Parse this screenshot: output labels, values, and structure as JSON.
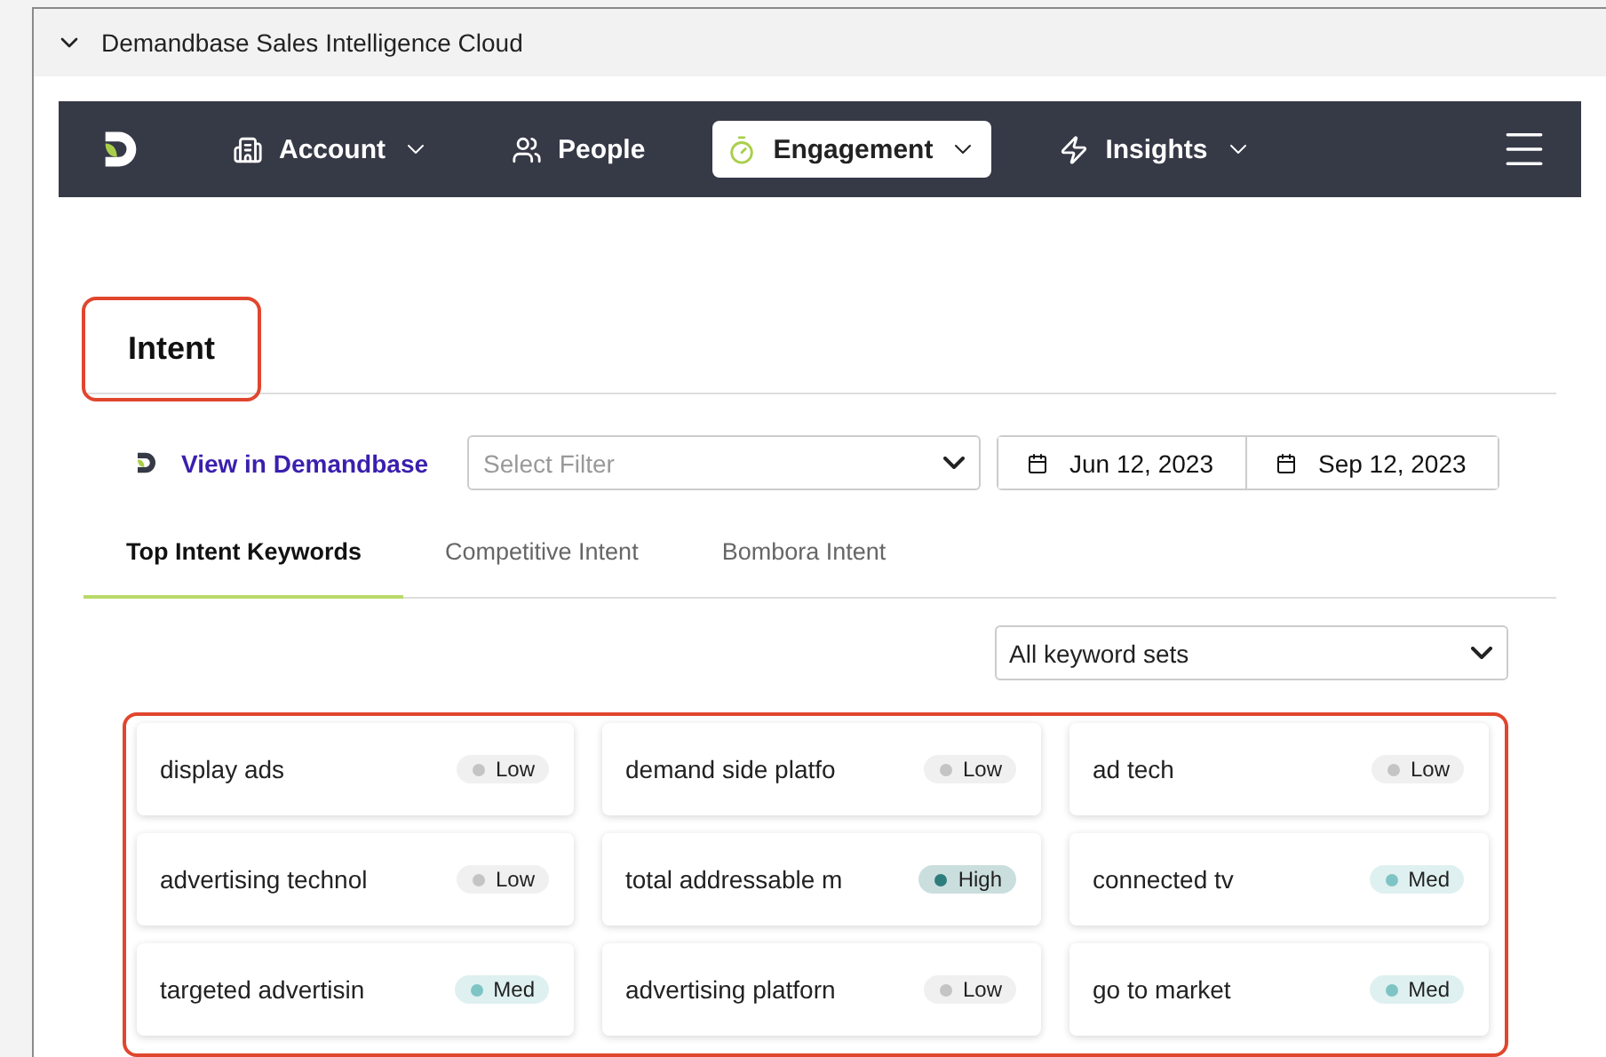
{
  "panel": {
    "title": "Demandbase Sales Intelligence Cloud",
    "expanded": true
  },
  "nav": {
    "items": [
      {
        "label": "Account",
        "kind": "building",
        "dropdown": true,
        "selected": false
      },
      {
        "label": "People",
        "kind": "people",
        "dropdown": false,
        "selected": false
      },
      {
        "label": "Engagement",
        "kind": "stopwatch",
        "dropdown": true,
        "selected": true
      },
      {
        "label": "Insights",
        "kind": "bolt",
        "dropdown": true,
        "selected": false
      }
    ]
  },
  "section": {
    "title": "Intent",
    "highlighted": true
  },
  "toolbar": {
    "link": "View in Demandbase",
    "filter": {
      "placeholder": "Select Filter"
    },
    "start_date": "Jun 12, 2023",
    "end_date": "Sep 12, 2023"
  },
  "tabs": [
    {
      "label": "Top Intent Keywords",
      "selected": true
    },
    {
      "label": "Competitive Intent",
      "selected": false
    },
    {
      "label": "Bombora Intent",
      "selected": false
    }
  ],
  "keyword_set": {
    "value": "All keyword sets"
  },
  "keywords_highlighted": true,
  "keywords": [
    {
      "name": "display ads",
      "intent": "Low",
      "color": "#c4c4c4"
    },
    {
      "name": "demand side platfo",
      "intent": "Low",
      "color": "#c4c4c4"
    },
    {
      "name": "ad tech",
      "intent": "Low",
      "color": "#c4c4c4"
    },
    {
      "name": "advertising technol",
      "intent": "Low",
      "color": "#c4c4c4"
    },
    {
      "name": "total addressable m",
      "intent": "High",
      "color": "#2e7d7d"
    },
    {
      "name": "connected tv",
      "intent": "Med",
      "color": "#7fc4c4"
    },
    {
      "name": "targeted advertisin",
      "intent": "Med",
      "color": "#7fc4c4"
    },
    {
      "name": "advertising platforn",
      "intent": "Low",
      "color": "#c4c4c4"
    },
    {
      "name": "go to market",
      "intent": "Med",
      "color": "#7fc4c4"
    }
  ]
}
